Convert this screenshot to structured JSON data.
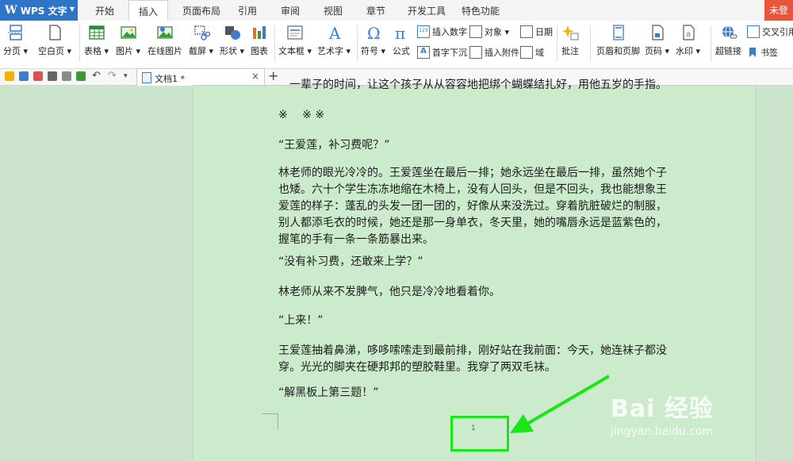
{
  "app": {
    "name": "WPS 文字"
  },
  "menu": {
    "tabs": [
      "开始",
      "插入",
      "页面布局",
      "引用",
      "审阅",
      "视图",
      "章节",
      "开发工具",
      "特色功能"
    ],
    "active": "插入",
    "right_button": "未登"
  },
  "ribbon": {
    "buttons": {
      "page_break": "分页",
      "blank_page": "空白页",
      "table": "表格",
      "picture": "图片",
      "online_picture": "在线图片",
      "screenshot": "截屏",
      "shape": "形状",
      "chart": "图表",
      "textbox": "文本框",
      "wordart": "艺术字",
      "symbol": "符号",
      "formula": "公式",
      "insert_number": "插入数字",
      "object": "对象",
      "date": "日期",
      "drop_cap": "首字下沉",
      "attachment": "插入附件",
      "field": "域",
      "comment": "批注",
      "header_footer": "页眉和页脚",
      "page_number": "页码",
      "watermark": "水印",
      "hyperlink": "超链接",
      "cross_ref": "交叉引用",
      "bookmark": "书签"
    }
  },
  "document": {
    "tab_title": "文档1 *",
    "close_symbol": "×",
    "new_tab_symbol": "+",
    "lines": [
      "一辈子的时间，让这个孩子从从容容地把绑个蝴蝶结扎好，用他五岁的手指。",
      "※　 ※ ※",
      "“王爱莲，补习费呢？”",
      "林老师的眼光冷冷的。王爱莲坐在最后一排；她永远坐在最后一排，虽然她个子",
      "也矮。六十个学生冻冻地缩在木椅上，没有人回头，但是不回头，我也能想象王",
      "爱莲的样子：蓬乱的头发一团一团的，好像从来没洗过。穿着肮脏破烂的制服，",
      "别人都添毛衣的时候，她还是那一身单衣，冬天里，她的嘴唇永远是蓝紫色的，",
      "握笔的手有一条一条筋暴出来。",
      "“没有补习费，还敢来上学？”",
      "林老师从来不发脾气，他只是冷冷地看着你。",
      "“上来！”",
      "王爱莲抽着鼻涕，哆哆嗦嗦走到最前排，刚好站在我前面：今天，她连袜子都没",
      "穿。光光的脚夹在硬邦邦的塑胶鞋里。我穿了两双毛袜。",
      "“解黑板上第三题！”"
    ],
    "page_number": "1"
  },
  "watermark": {
    "main": "Bai 经验",
    "sub": "jingyan.baidu.com"
  },
  "colors": {
    "accent_blue": "#2f75c7",
    "highlight_green": "#19e619",
    "page_bg": "#ccebcc",
    "login_red": "#e8553a"
  }
}
